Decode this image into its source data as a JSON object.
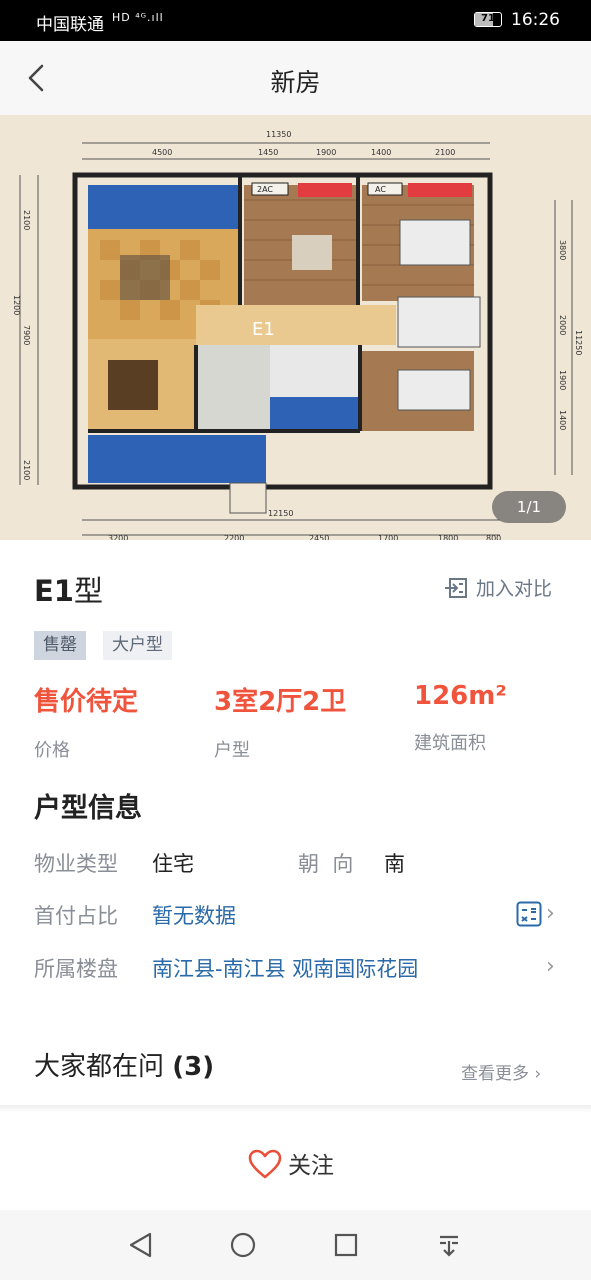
{
  "status_bar": {
    "carrier": "中国联通",
    "network_icons": "HD ⁴ᴳ.ıll",
    "battery": "71",
    "battery_level": 0.71,
    "time": "16:26"
  },
  "nav": {
    "title": "新房",
    "back_icon": "chevron-left-icon"
  },
  "gallery": {
    "counter": "1/1",
    "plan": {
      "top_total": "11350",
      "top_dims": [
        "4500",
        "1450",
        "1900",
        "1400",
        "2100"
      ],
      "left_dims": [
        "2100",
        "1200",
        "7900",
        "2100"
      ],
      "right_dims": [
        "3800",
        "2000",
        "1900",
        "1400"
      ],
      "right_total": "11250",
      "bottom_total": "12150",
      "bottom_dims": [
        "3200",
        "2200",
        "2450",
        "1700",
        "1800",
        "800"
      ],
      "ac_labels": [
        "2AC",
        "AC"
      ],
      "unit_label": "E1"
    }
  },
  "unit": {
    "name_latin": "E1",
    "name_suffix": "型",
    "compare_label": "加入对比",
    "tags": [
      "售罄",
      "大户型"
    ],
    "stats": [
      {
        "value": "售价待定",
        "label": "价格"
      },
      {
        "value": "3室2厅2卫",
        "label": "户型"
      },
      {
        "value": "126m²",
        "label": "建筑面积"
      }
    ]
  },
  "info": {
    "section_title": "户型信息",
    "property_type_label": "物业类型",
    "property_type_value": "住宅",
    "orientation_label": "朝  向",
    "orientation_value": "南",
    "down_payment_label": "首付占比",
    "down_payment_value": "暂无数据",
    "estate_label": "所属楼盘",
    "estate_value": "南江县-南江县 观南国际花园"
  },
  "qa": {
    "title": "大家都在问",
    "count": "(3)",
    "more_label": "查看更多"
  },
  "footer": {
    "follow_label": "关注"
  },
  "colors": {
    "accent_red": "#f0543c",
    "link_blue": "#2b6aa8",
    "muted_gray": "#8a8f97"
  }
}
